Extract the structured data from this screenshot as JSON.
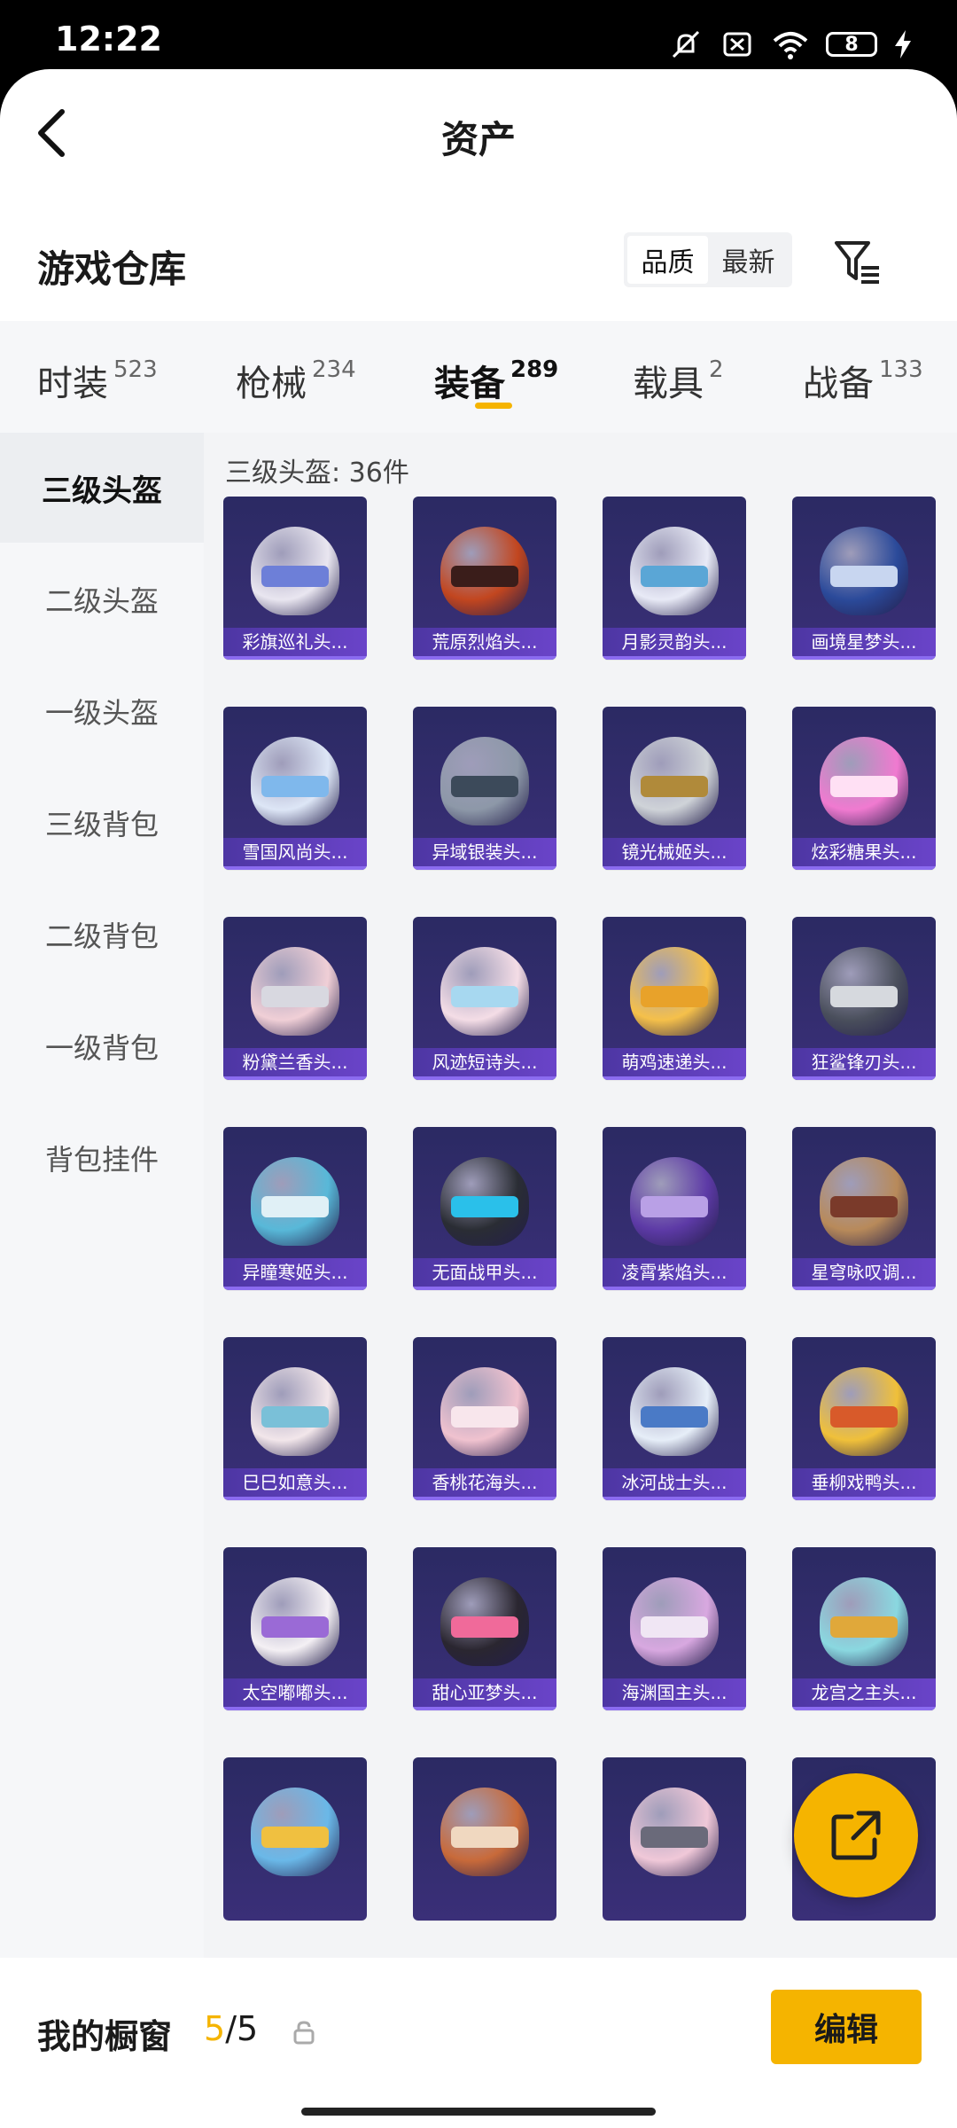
{
  "status": {
    "time": "12:22",
    "battery": "8",
    "icons": [
      "mute-icon",
      "sim-off-icon",
      "wifi-icon",
      "battery-icon",
      "charging-icon"
    ]
  },
  "header": {
    "title": "资产"
  },
  "warehouse": {
    "title": "游戏仓库",
    "sort_options": [
      "品质",
      "最新"
    ],
    "active_sort": "品质"
  },
  "tabs": [
    {
      "label": "时装",
      "count": "523"
    },
    {
      "label": "枪械",
      "count": "234"
    },
    {
      "label": "装备",
      "count": "289",
      "active": true
    },
    {
      "label": "载具",
      "count": "2"
    },
    {
      "label": "战备",
      "count": "133"
    }
  ],
  "sidebar": [
    {
      "label": "三级头盔",
      "active": true
    },
    {
      "label": "二级头盔"
    },
    {
      "label": "一级头盔"
    },
    {
      "label": "三级背包"
    },
    {
      "label": "二级背包"
    },
    {
      "label": "一级背包"
    },
    {
      "label": "背包挂件"
    }
  ],
  "content": {
    "count_label": "三级头盔: 36件",
    "items": [
      {
        "name": "彩旗巡礼头...",
        "color": "#e9e6f0",
        "visor": "#6d7fd8"
      },
      {
        "name": "荒原烈焰头...",
        "color": "#c2461f",
        "visor": "#3a1d1a"
      },
      {
        "name": "月影灵韵头...",
        "color": "#e8eaf6",
        "visor": "#5aa6d6"
      },
      {
        "name": "画境星梦头...",
        "color": "#2b4a9a",
        "visor": "#c8d6f0"
      },
      {
        "name": "雪国风尚头...",
        "color": "#dde6f6",
        "visor": "#7fb8ec"
      },
      {
        "name": "异域银装头...",
        "color": "#8d98a8",
        "visor": "#3c4a5a"
      },
      {
        "name": "镜光械姬头...",
        "color": "#cfd3d8",
        "visor": "#b08a3a"
      },
      {
        "name": "炫彩糖果头...",
        "color": "#f07ad0",
        "visor": "#ffe0f4"
      },
      {
        "name": "粉黛兰香头...",
        "color": "#f0cfd6",
        "visor": "#d8d8e0"
      },
      {
        "name": "风迹短诗头...",
        "color": "#f4dde6",
        "visor": "#a7d8f0"
      },
      {
        "name": "萌鸡速递头...",
        "color": "#f5c04a",
        "visor": "#e8a22a"
      },
      {
        "name": "狂鲨锋刃头...",
        "color": "#4a4f5c",
        "visor": "#d6d9de"
      },
      {
        "name": "异瞳寒姬头...",
        "color": "#58b8d8",
        "visor": "#e0f0f6"
      },
      {
        "name": "无面战甲头...",
        "color": "#2a2d34",
        "visor": "#2ac0ea"
      },
      {
        "name": "凌霄紫焰头...",
        "color": "#5d3aa6",
        "visor": "#b9a0e6"
      },
      {
        "name": "星穹咏叹调...",
        "color": "#b88a5a",
        "visor": "#7a3a2a"
      },
      {
        "name": "巳巳如意头...",
        "color": "#f2e6ea",
        "visor": "#7ac0d8"
      },
      {
        "name": "香桃花海头...",
        "color": "#f0c2cf",
        "visor": "#f8e6ec"
      },
      {
        "name": "冰河战士头...",
        "color": "#e6eef8",
        "visor": "#4a7ac6"
      },
      {
        "name": "垂柳戏鸭头...",
        "color": "#f0c03a",
        "visor": "#d85a2a"
      },
      {
        "name": "太空嘟嘟头...",
        "color": "#f4f0f4",
        "visor": "#9a6ad6"
      },
      {
        "name": "甜心亚梦头...",
        "color": "#2a2630",
        "visor": "#f06a9a"
      },
      {
        "name": "海渊国主头...",
        "color": "#d8a8e0",
        "visor": "#f0e6f4"
      },
      {
        "name": "龙宫之主头...",
        "color": "#8ad8e0",
        "visor": "#e0a83a"
      },
      {
        "name": "",
        "color": "#6ab8e8",
        "visor": "#f0c040"
      },
      {
        "name": "",
        "color": "#c86a3a",
        "visor": "#f0d8c0"
      },
      {
        "name": "",
        "color": "#f0c8d8",
        "visor": "#6a6a7a"
      },
      {
        "name": "",
        "color": "#c8d4e0",
        "visor": "#4a5a6a"
      }
    ]
  },
  "footer": {
    "window_label": "我的橱窗",
    "window_used": "5",
    "window_total": "/5",
    "edit_label": "编辑"
  },
  "colors": {
    "accent": "#f5b400",
    "card_bar": "#5a3cb8"
  }
}
